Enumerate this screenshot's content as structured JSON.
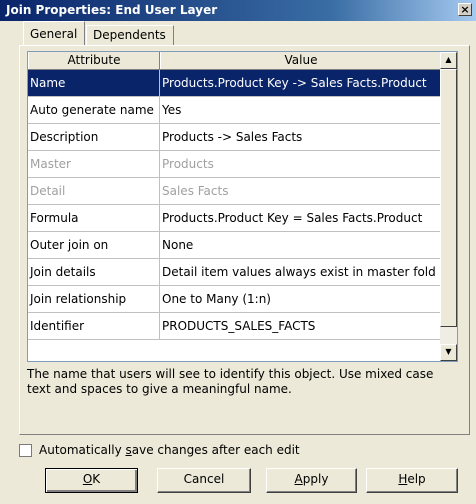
{
  "window": {
    "title": "Join Properties: End User Layer",
    "close_glyph": "×"
  },
  "tabs": [
    {
      "label": "General",
      "active": true
    },
    {
      "label": "Dependents",
      "active": false
    }
  ],
  "grid": {
    "headers": {
      "attribute": "Attribute",
      "value": "Value"
    },
    "rows": [
      {
        "attribute": "Name",
        "value": "Products.Product Key -> Sales Facts.Product",
        "state": "selected"
      },
      {
        "attribute": "Auto generate name",
        "value": "Yes",
        "state": "normal"
      },
      {
        "attribute": "Description",
        "value": "Products -> Sales Facts",
        "state": "normal"
      },
      {
        "attribute": "Master",
        "value": "Products",
        "state": "disabled"
      },
      {
        "attribute": "Detail",
        "value": "Sales Facts",
        "state": "disabled"
      },
      {
        "attribute": "Formula",
        "value": "Products.Product Key = Sales Facts.Product",
        "state": "normal"
      },
      {
        "attribute": "Outer join on",
        "value": "None",
        "state": "normal"
      },
      {
        "attribute": "Join details",
        "value": "Detail item values always exist in master fold",
        "state": "normal"
      },
      {
        "attribute": "Join relationship",
        "value": "One to Many (1:n)",
        "state": "normal"
      },
      {
        "attribute": "Identifier",
        "value": "PRODUCTS_SALES_FACTS",
        "state": "normal"
      }
    ],
    "scroll_up_icon": "▲",
    "scroll_down_icon": "▼"
  },
  "description": "The name that users will see to identify this object. Use mixed case text and spaces to give a meaningful name.",
  "autosave": {
    "checked": false,
    "label_pre": "Automatically ",
    "label_accel": "s",
    "label_post": "ave changes after each edit"
  },
  "buttons": {
    "ok": {
      "accel": "O",
      "rest": "K"
    },
    "cancel": {
      "label": "Cancel"
    },
    "apply": {
      "accel": "A",
      "rest": "pply"
    },
    "help": {
      "accel": "H",
      "rest": "elp"
    }
  },
  "colors": {
    "selection": "#0a246a",
    "dialog_bg": "#ece9d8"
  }
}
